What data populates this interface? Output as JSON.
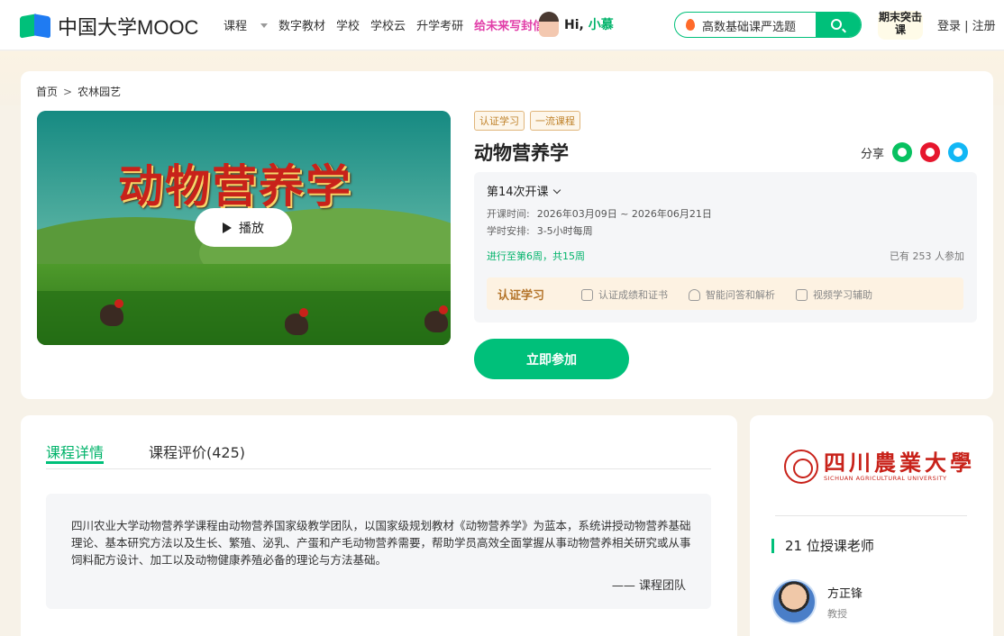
{
  "header": {
    "logo_text": "中国大学MOOC",
    "nav": [
      "课程",
      "数字教材",
      "学校",
      "学校云",
      "升学考研",
      "给未来写封信"
    ],
    "greeting_prefix": "Hi,",
    "greeting_name": "小慕",
    "search_placeholder": "高数基础课严选题",
    "badge": "期末突击课",
    "login": "登录 | 注册"
  },
  "breadcrumb": [
    "首页",
    "农林园艺"
  ],
  "course": {
    "cover_title": "动物营养学",
    "play_label": "播放",
    "tags": [
      "认证学习",
      "一流课程"
    ],
    "title": "动物营养学",
    "share_label": "分享",
    "term": "第14次开课",
    "open_time_label": "开课时间:",
    "open_time": "2026年03月09日 ~ 2026年06月21日",
    "schedule_label": "学时安排:",
    "schedule": "3-5小时每周",
    "progress": "进行至第6周，共15周",
    "joined": "已有 253 人参加",
    "cert_label": "认证学习",
    "cert_features": [
      "认证成绩和证书",
      "智能问答和解析",
      "视频学习辅助"
    ],
    "join_button": "立即参加"
  },
  "detail": {
    "tabs": [
      "课程详情",
      "课程评价(425)"
    ],
    "active_tab": 0,
    "intro": "四川农业大学动物营养学课程由动物营养国家级教学团队，以国家级规划教材《动物营养学》为蓝本，系统讲授动物营养基础理论、基本研究方法以及生长、繁殖、泌乳、产蛋和产毛动物营养需要，帮助学员高效全面掌握从事动物营养相关研究或从事饲料配方设计、加工以及动物健康养殖必备的理论与方法基础。",
    "signature": "—— 课程团队"
  },
  "school": {
    "name_cn": "四川農業大學",
    "name_en": "SICHUAN AGRICULTURAL UNIVERSITY",
    "teachers_heading": "21 位授课老师",
    "teacher_name": "方正锋",
    "teacher_title": "教授"
  },
  "colors": {
    "accent": "#00c07a",
    "promo": "#e13ea8",
    "brand_red": "#c8221a"
  }
}
